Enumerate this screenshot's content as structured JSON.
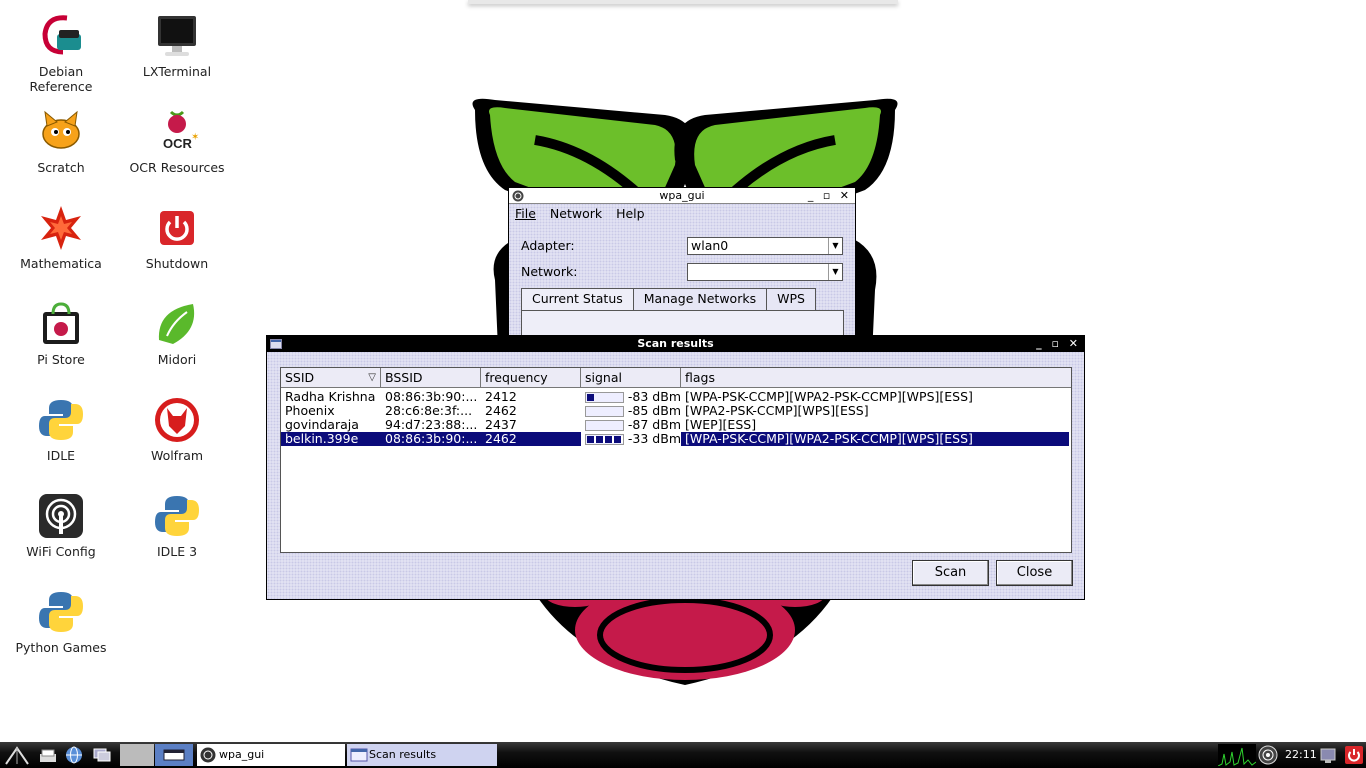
{
  "desktop": {
    "icons": [
      {
        "label": "Debian\nReference",
        "icon": "debian-icon"
      },
      {
        "label": "LXTerminal",
        "icon": "terminal-icon"
      },
      {
        "label": "Scratch",
        "icon": "scratch-cat-icon"
      },
      {
        "label": "OCR Resources",
        "icon": "ocr-raspberry-icon"
      },
      {
        "label": "Mathematica",
        "icon": "mathematica-star-icon"
      },
      {
        "label": "Shutdown",
        "icon": "power-icon"
      },
      {
        "label": "Pi Store",
        "icon": "pi-store-bag-icon"
      },
      {
        "label": "Midori",
        "icon": "midori-leaf-icon"
      },
      {
        "label": "IDLE",
        "icon": "python-icon"
      },
      {
        "label": "Wolfram",
        "icon": "wolfram-icon"
      },
      {
        "label": "WiFi Config",
        "icon": "wifi-config-icon"
      },
      {
        "label": "IDLE 3",
        "icon": "python-icon"
      },
      {
        "label": "Python Games",
        "icon": "python-icon"
      }
    ]
  },
  "wpa_gui": {
    "title": "wpa_gui",
    "menu": [
      "File",
      "Network",
      "Help"
    ],
    "adapter_label": "Adapter:",
    "adapter_value": "wlan0",
    "network_label": "Network:",
    "network_value": "",
    "tabs": [
      "Current Status",
      "Manage Networks",
      "WPS"
    ]
  },
  "scan_results": {
    "title": "Scan results",
    "columns": [
      "SSID",
      "BSSID",
      "frequency",
      "signal",
      "flags"
    ],
    "rows": [
      {
        "ssid": "Radha Krishna",
        "bssid": "08:86:3b:90:...",
        "frequency": "2412",
        "signal": "-83 dBm",
        "signal_level": 0.2,
        "flags": "[WPA-PSK-CCMP][WPA2-PSK-CCMP][WPS][ESS]",
        "selected": false
      },
      {
        "ssid": "Phoenix",
        "bssid": "28:c6:8e:3f:...",
        "frequency": "2462",
        "signal": "-85 dBm",
        "signal_level": 0.0,
        "flags": "[WPA2-PSK-CCMP][WPS][ESS]",
        "selected": false
      },
      {
        "ssid": "govindaraja",
        "bssid": "94:d7:23:88:...",
        "frequency": "2437",
        "signal": "-87 dBm",
        "signal_level": 0.0,
        "flags": "[WEP][ESS]",
        "selected": false
      },
      {
        "ssid": "belkin.399e",
        "bssid": "08:86:3b:90:...",
        "frequency": "2462",
        "signal": "-33 dBm",
        "signal_level": 1.0,
        "flags": "[WPA-PSK-CCMP][WPA2-PSK-CCMP][WPS][ESS]",
        "selected": true
      }
    ],
    "scan_button": "Scan",
    "close_button": "Close"
  },
  "taskbar": {
    "tasks": [
      "wpa_gui",
      "Scan results"
    ],
    "clock": "22:11"
  },
  "colors": {
    "selection": "#0b0b7a",
    "leaf_green": "#6cbf2a",
    "berry": "#c51a4a"
  }
}
